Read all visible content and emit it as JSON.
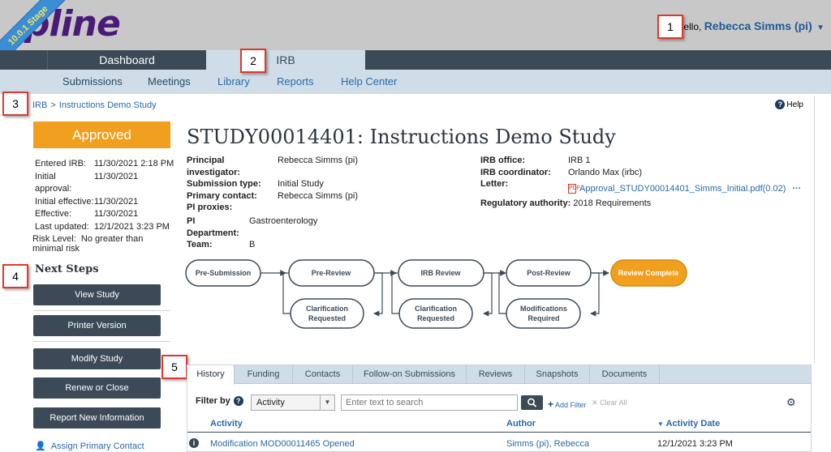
{
  "header": {
    "logo_text": "Huron Click Portal logo",
    "logo_display": "pline",
    "stage_label": "10.0.1 Stage",
    "greeting": "Hello,",
    "user_name": "Rebecca Simms (pi)"
  },
  "nav": {
    "tabs": [
      {
        "label": "Dashboard"
      },
      {
        "label": "IRB"
      }
    ]
  },
  "subnav": {
    "items": [
      {
        "label": "Submissions"
      },
      {
        "label": "Meetings"
      },
      {
        "label": "Library"
      },
      {
        "label": "Reports"
      },
      {
        "label": "Help Center"
      }
    ]
  },
  "callouts": [
    "1",
    "2",
    "3",
    "4",
    "5"
  ],
  "breadcrumb": {
    "root": "IRB",
    "separator": ">",
    "current": "Instructions Demo Study"
  },
  "help_label": "Help",
  "left": {
    "status": "Approved",
    "dates": [
      {
        "label": "Entered IRB:",
        "value": "11/30/2021 2:18 PM"
      },
      {
        "label": "Initial approval:",
        "value": "11/30/2021"
      },
      {
        "label": "Initial effective:",
        "value": "11/30/2021"
      },
      {
        "label": "Effective:",
        "value": "11/30/2021"
      },
      {
        "label": "Last updated:",
        "value": "12/1/2021 3:23 PM"
      }
    ],
    "risk_label": "Risk Level:",
    "risk_value": "No greater than minimal risk",
    "next_steps_title": "Next Steps",
    "buttons": [
      "View Study",
      "Printer Version",
      "Modify Study",
      "Renew or Close",
      "Report New Information"
    ],
    "assign_link": "Assign Primary Contact"
  },
  "study": {
    "title": "STUDY00014401: Instructions Demo Study",
    "left_details": [
      {
        "label": "Principal investigator:",
        "value": "Rebecca Simms (pi)"
      },
      {
        "label": "Submission type:",
        "value": "Initial Study"
      },
      {
        "label": "Primary contact:",
        "value": "Rebecca Simms (pi)"
      },
      {
        "label": "PI proxies:",
        "value": ""
      }
    ],
    "right_details": [
      {
        "label": "IRB office:",
        "value": "IRB 1"
      },
      {
        "label": "IRB coordinator:",
        "value": "Orlando Max (irbc)"
      }
    ],
    "letter_label": "Letter:",
    "letter_file": "Approval_STUDY00014401_Simms_Initial.pdf(0.02)",
    "letter_more": "···",
    "reg_label": "Regulatory authority:",
    "reg_value": "2018 Requirements",
    "dept_details": [
      {
        "label": "PI Department:",
        "value": "Gastroenterology"
      },
      {
        "label": "Team:",
        "value": "B"
      }
    ]
  },
  "workflow": {
    "steps": [
      "Pre-Submission",
      "Pre-Review",
      "IRB Review",
      "Post-Review",
      "Review Complete"
    ],
    "loops": [
      [
        "Clarification",
        "Requested"
      ],
      [
        "Clarification",
        "Requested"
      ],
      [
        "Modifications",
        "Required"
      ]
    ],
    "active_color": "#f0a01e"
  },
  "tabs": {
    "items": [
      "History",
      "Funding",
      "Contacts",
      "Follow-on Submissions",
      "Reviews",
      "Snapshots",
      "Documents"
    ],
    "active": "History"
  },
  "filter": {
    "label": "Filter by",
    "select_value": "Activity",
    "search_placeholder": "Enter text to search",
    "add_filter": "Add Filter",
    "clear_all": "Clear All"
  },
  "table": {
    "headers": [
      "Activity",
      "Author",
      "Activity Date"
    ],
    "sort_indicator": "▼",
    "rows": [
      {
        "activity": "Modification MOD00011465 Opened",
        "author": "Simms (pi), Rebecca",
        "date": "12/1/2021 3:23 PM"
      }
    ]
  }
}
